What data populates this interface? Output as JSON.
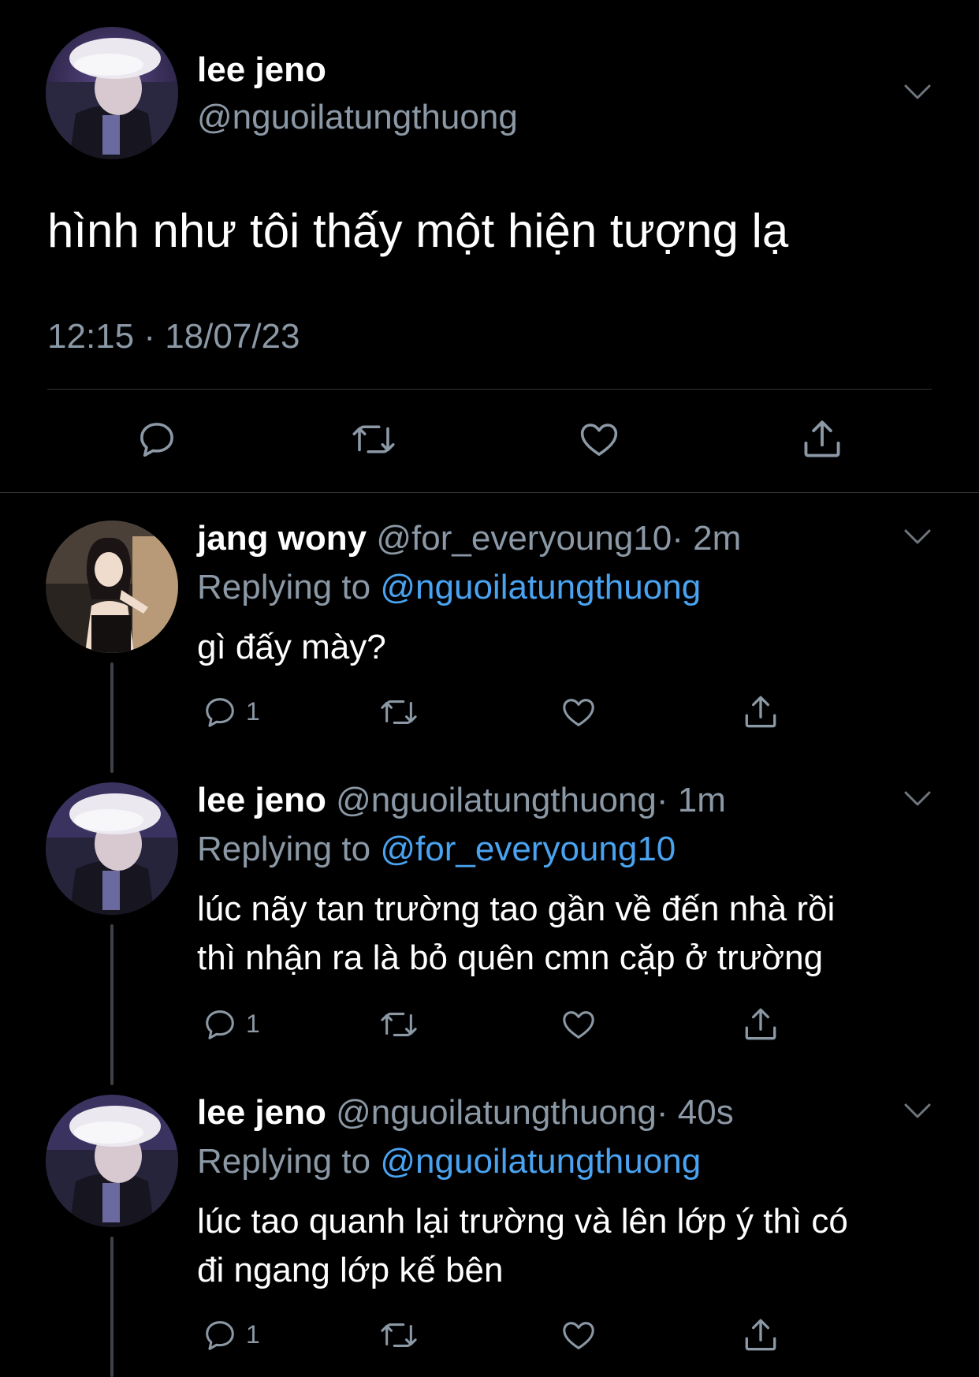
{
  "main_tweet": {
    "display_name": "lee jeno",
    "handle": "@nguoilatungthuong",
    "text": "hình như tôi thấy một hiện tượng lạ",
    "timestamp": "12:15 · 18/07/23"
  },
  "replies": [
    {
      "display_name": "jang wony",
      "handle": "@for_everyoung10",
      "time": "· 2m",
      "replying_prefix": "Replying to",
      "replying_to": "@nguoilatungthuong",
      "lines": [
        "gì đấy mày?"
      ],
      "reply_count": "1"
    },
    {
      "display_name": "lee jeno",
      "handle": "@nguoilatungthuong",
      "time": "· 1m",
      "replying_prefix": "Replying to",
      "replying_to": "@for_everyoung10",
      "lines": [
        "lúc nãy tan trường tao gần về đến nhà rồi",
        "thì nhận ra là bỏ quên cmn cặp ở trường"
      ],
      "reply_count": "1"
    },
    {
      "display_name": "lee jeno",
      "handle": "@nguoilatungthuong",
      "time": "· 40s",
      "replying_prefix": "Replying to",
      "replying_to": "@nguoilatungthuong",
      "lines": [
        "lúc tao quanh lại trường và lên lớp ý thì có",
        "đi ngang lớp kế bên"
      ],
      "reply_count": "1"
    }
  ],
  "icons": {
    "reply": "reply-icon",
    "retweet": "retweet-icon",
    "like": "heart-icon",
    "share": "share-icon",
    "more": "chevron-down-icon"
  },
  "colors": {
    "background": "#000000",
    "text": "#ffffff",
    "secondary": "#8b98a5",
    "link": "#4aa3f0",
    "divider": "#2f3336"
  }
}
